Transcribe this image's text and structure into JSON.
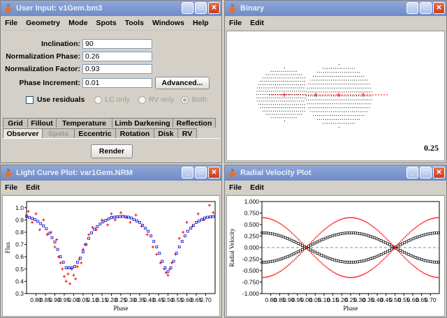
{
  "colors": {
    "title_active": "#1e50c8",
    "title_inactive": "#7f98d0",
    "data_red": "#ff0000",
    "model_blue": "#0000cc",
    "point_black": "#000000"
  },
  "user_input": {
    "title": "User Input: v1Gem.bm3",
    "menu": [
      "File",
      "Geometry",
      "Mode",
      "Spots",
      "Tools",
      "Windows",
      "Help"
    ],
    "fields": [
      {
        "label": "Inclination:",
        "value": "90"
      },
      {
        "label": "Normalization Phase:",
        "value": "0.26"
      },
      {
        "label": "Normalization Factor:",
        "value": "0.93"
      },
      {
        "label": "Phase Increment:",
        "value": "0.01"
      }
    ],
    "advanced_label": "Advanced...",
    "use_residuals_label": "Use residuals",
    "radio_lc": "LC only",
    "radio_rv": "RV only",
    "radio_both": "Both",
    "tabs_row1": [
      "Grid",
      "Fillout",
      "Temperature",
      "Limb Darkening",
      "Reflection"
    ],
    "tabs_row2": [
      "Observer",
      "Spots",
      "Eccentric",
      "Rotation",
      "Disk",
      "RV"
    ],
    "render_label": "Render"
  },
  "binary": {
    "title": "Binary",
    "menu": [
      "File",
      "Edit"
    ],
    "phase_readout": "0.25"
  },
  "light_curve": {
    "title": "Light Curve Plot: var1Gem.NRM",
    "menu": [
      "File",
      "Edit"
    ],
    "chart_data": {
      "type": "scatter",
      "xlabel": "Phase",
      "ylabel": "Flux",
      "xlim": [
        0.75,
        1.75
      ],
      "ylim": [
        0.3,
        1.05
      ],
      "x_ticks": [
        "0.80",
        "0.85",
        "0.90",
        "0.95",
        "0.00",
        "0.05",
        "0.10",
        "0.15",
        "0.20",
        "0.25",
        "0.30",
        "0.35",
        "0.40",
        "0.45",
        "0.50",
        "0.55",
        "0.60",
        "0.65",
        "0.70"
      ],
      "y_ticks": [
        "0.3",
        "0.4",
        "0.5",
        "0.6",
        "0.7",
        "0.8",
        "0.9",
        "1.0"
      ],
      "series": [
        {
          "marker": "square",
          "color": "#0000cc",
          "x": [
            0.75,
            0.8,
            0.85,
            0.9,
            0.93,
            0.96,
            1.0,
            1.04,
            1.07,
            1.1,
            1.15,
            1.2,
            1.26,
            1.3,
            1.35,
            1.4,
            1.45,
            1.48,
            1.5,
            1.52,
            1.55,
            1.6,
            1.65,
            1.7,
            1.75
          ],
          "y": [
            0.93,
            0.9,
            0.84,
            0.72,
            0.6,
            0.51,
            0.51,
            0.6,
            0.72,
            0.81,
            0.88,
            0.92,
            0.93,
            0.92,
            0.88,
            0.8,
            0.65,
            0.52,
            0.48,
            0.52,
            0.65,
            0.8,
            0.88,
            0.92,
            0.93
          ]
        },
        {
          "marker": "plus",
          "color": "#ff0000",
          "x": [
            0.76,
            0.78,
            0.8,
            0.82,
            0.84,
            0.86,
            0.88,
            0.9,
            0.91,
            0.92,
            0.93,
            0.94,
            0.95,
            0.96,
            0.97,
            0.98,
            0.99,
            1.0,
            1.01,
            1.02,
            1.03,
            1.04,
            1.05,
            1.06,
            1.08,
            1.1,
            1.12,
            1.15,
            1.18,
            1.2,
            1.22,
            1.25,
            1.28,
            1.3,
            1.33,
            1.36,
            1.39,
            1.42,
            1.44,
            1.46,
            1.48,
            1.49,
            1.5,
            1.51,
            1.52,
            1.54,
            1.56,
            1.58,
            1.6,
            1.63,
            1.66,
            1.69,
            1.72,
            1.74
          ],
          "y": [
            0.97,
            0.88,
            0.95,
            0.82,
            0.9,
            0.78,
            0.8,
            0.68,
            0.74,
            0.6,
            0.55,
            0.5,
            0.44,
            0.4,
            0.46,
            0.38,
            0.5,
            0.45,
            0.42,
            0.52,
            0.58,
            0.55,
            0.66,
            0.7,
            0.78,
            0.84,
            0.82,
            0.9,
            0.86,
            0.95,
            0.9,
            0.96,
            0.92,
            0.88,
            0.94,
            0.85,
            0.78,
            0.68,
            0.62,
            0.55,
            0.5,
            0.47,
            0.45,
            0.5,
            0.55,
            0.62,
            0.75,
            0.8,
            0.88,
            0.85,
            0.95,
            0.9,
            1.02,
            0.96
          ]
        }
      ]
    }
  },
  "radial_velocity": {
    "title": "Radial Velocity Plot",
    "menu": [
      "File",
      "Edit"
    ],
    "chart_data": {
      "type": "scatter",
      "xlabel": "Phase",
      "ylabel": "Radial Velocity",
      "xlim": [
        0.75,
        1.75
      ],
      "ylim": [
        -1.0,
        1.0
      ],
      "x_ticks": [
        "0.80",
        "0.85",
        "0.90",
        "0.95",
        "0.00",
        "0.05",
        "0.10",
        "0.15",
        "0.20",
        "0.25",
        "0.30",
        "0.35",
        "0.40",
        "0.45",
        "0.50",
        "0.55",
        "0.60",
        "0.65",
        "0.70"
      ],
      "y_ticks": [
        "1.000",
        "0.750",
        "0.500",
        "0.250",
        "0.000",
        "-0.250",
        "-0.500",
        "-0.750",
        "-1.000"
      ],
      "series": [
        {
          "marker": "square",
          "color": "#000000",
          "phase_offset": 0.0,
          "amplitude": 0.32
        },
        {
          "marker": "square",
          "color": "#000000",
          "phase_offset": 0.5,
          "amplitude": 0.32
        },
        {
          "marker": "dot",
          "color": "#ff0000",
          "phase_offset": 0.0,
          "amplitude": 0.65
        },
        {
          "marker": "dot",
          "color": "#ff0000",
          "phase_offset": 0.5,
          "amplitude": 0.65
        }
      ]
    }
  }
}
